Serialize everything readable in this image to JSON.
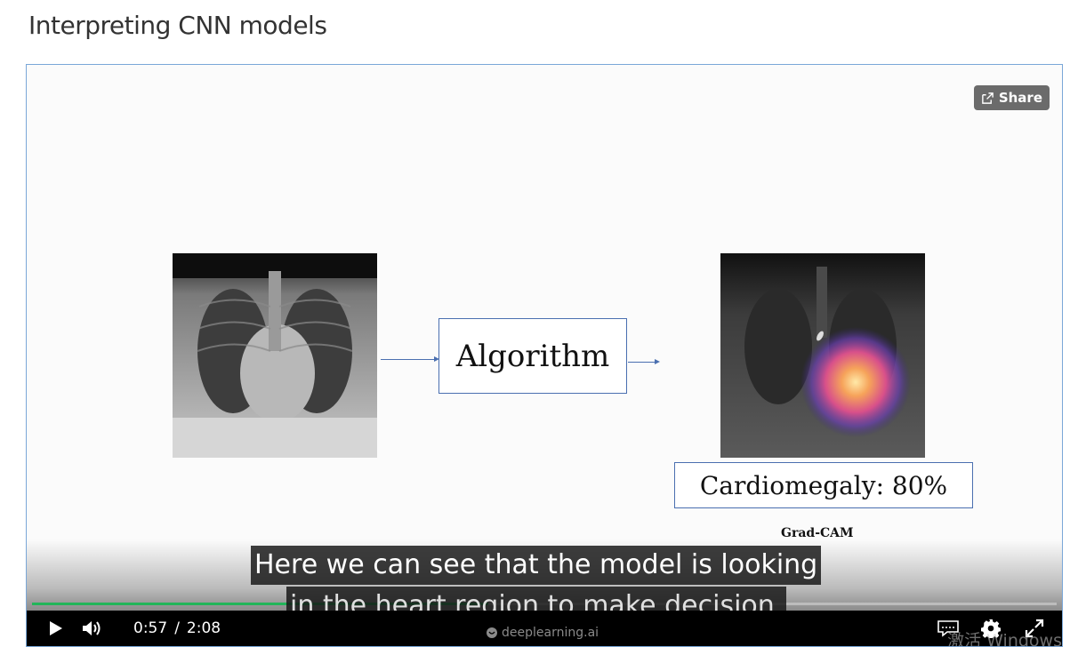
{
  "page": {
    "title": "Interpreting CNN models"
  },
  "player": {
    "share_label": "Share",
    "slide": {
      "algorithm_label": "Algorithm",
      "diagnosis_label": "Cardiomegaly: 80%",
      "method_label": "Grad-CAM"
    },
    "captions": {
      "line1": "Here we can see that the model is looking",
      "line2": "in the heart region to make decision."
    },
    "progress": {
      "fraction": 0.445,
      "color": "#21b559"
    },
    "time": {
      "current": "0:57",
      "separator": "/",
      "total": "2:08"
    },
    "brand": "deeplearning.ai",
    "watermark": "激活 Windows"
  },
  "colors": {
    "accent": "#21b559",
    "border": "#7aa7d8",
    "diagram": "#4a6fb0"
  }
}
